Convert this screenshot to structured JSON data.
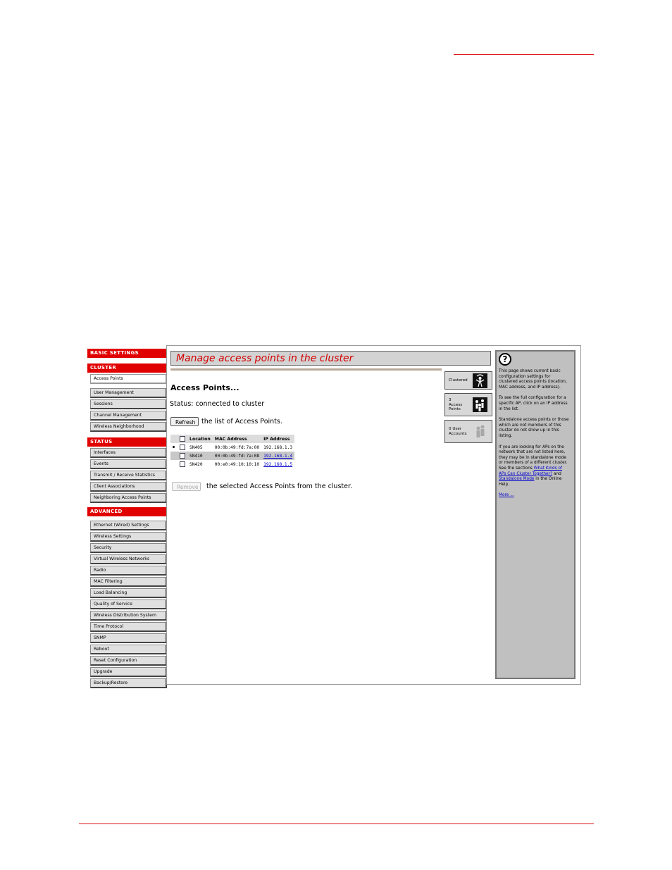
{
  "sidebar": {
    "basic_settings": "BASIC SETTINGS",
    "cluster": {
      "label": "CLUSTER",
      "items": [
        "Access Points",
        "User Management",
        "Sessions",
        "Channel Management",
        "Wireless Neighborhood"
      ]
    },
    "status": {
      "label": "STATUS",
      "items": [
        "Interfaces",
        "Events",
        "Transmit / Receive Statistics",
        "Client Associations",
        "Neighboring Access Points"
      ]
    },
    "advanced": {
      "label": "ADVANCED",
      "items": [
        "Ethernet (Wired) Settings",
        "Wireless Settings",
        "Security",
        "Virtual Wireless Networks",
        "Radio",
        "MAC Filtering",
        "Load Balancing",
        "Quality of Service",
        "Wireless Distribution System",
        "Time Protocol",
        "SNMP",
        "Reboot",
        "Reset Configuration",
        "Upgrade",
        "Backup/Restore"
      ]
    }
  },
  "main": {
    "title": "Manage access points in the cluster",
    "heading": "Access Points...",
    "status_text": "Status: connected to cluster",
    "refresh_label": "Refresh",
    "refresh_suffix": "the list of Access Points.",
    "table": {
      "headers": [
        "Location",
        "MAC Address",
        "IP Address"
      ],
      "rows": [
        {
          "location": "SN405",
          "mac": "00:0b:49:fd:7a:00",
          "ip": "192.168.1.3"
        },
        {
          "location": "SN410",
          "mac": "00:0b:49:fd:7a:08",
          "ip": "192.168.1.4"
        },
        {
          "location": "SN420",
          "mac": "00:e0:49:10:10:10",
          "ip": "192.168.1.5"
        }
      ]
    },
    "remove_label": "Remove",
    "remove_suffix": "the selected Access Points from the cluster."
  },
  "tiles": {
    "clustered": "Clustered",
    "ap_count": "3",
    "ap_label_1": "Access",
    "ap_label_2": "Points",
    "user_count_label": "0 User",
    "user_accounts": "Accounts"
  },
  "help": {
    "icon": "?",
    "p1": "This page shows current basic configuration settings for clustered access points (location, MAC address, and IP address).",
    "p2": "To see the full configuration for a specific AP, click on an IP address in the list.",
    "p3": "Standalone access points or those which are not members of this cluster do not show up in this listing.",
    "p4_a": "If you are looking for APs on the network that are not listed here, they may be in standalone mode or members of a different cluster. See the sections",
    "link1": "What Kinds of APs Can Cluster Together?",
    "p4_b": "and",
    "link2": "Standalone Mode",
    "p4_c": "in the Online Help.",
    "more": "More ..."
  }
}
